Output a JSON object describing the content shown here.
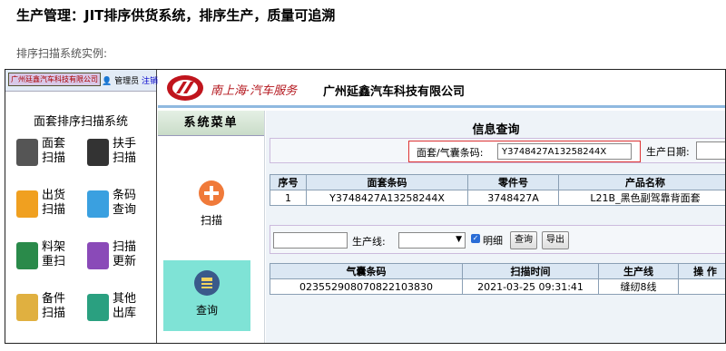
{
  "heading": "生产管理：JIT排序供货系统，排序生产，质量可追溯",
  "subheading": "排序扫描系统实例:",
  "phone": {
    "company": "广州廷鑫汽车科技有限公司",
    "user_prefix": "管理员",
    "user_link": "注销",
    "title": "面套排序扫描系统",
    "items": [
      {
        "label": "面套\n扫描",
        "icon": "seat-icon",
        "color": "#555555"
      },
      {
        "label": "扶手\n扫描",
        "icon": "armrest-icon",
        "color": "#333333"
      },
      {
        "label": "出货\n扫描",
        "icon": "truck-icon",
        "color": "#f0a020"
      },
      {
        "label": "条码\n查询",
        "icon": "barcode-search-icon",
        "color": "#3aa0e0"
      },
      {
        "label": "料架\n重扫",
        "icon": "rack-icon",
        "color": "#2a8a4a"
      },
      {
        "label": "扫描\n更新",
        "icon": "update-icon",
        "color": "#8a4ab8"
      },
      {
        "label": "备件\n扫描",
        "icon": "box-icon",
        "color": "#e0b040"
      },
      {
        "label": "其他\n出库",
        "icon": "export-icon",
        "color": "#2aa080"
      }
    ]
  },
  "desktop": {
    "brand": "南上海·汽车服务",
    "company": "广州延鑫汽车科技有限公司",
    "menu_title": "系统菜单",
    "menu_scan": "扫描",
    "menu_query": "查询",
    "info_title": "信息查询",
    "search": {
      "label": "面套/气囊条码:",
      "value": "Y3748427A13258244X",
      "date_label": "生产日期:"
    },
    "table1": {
      "headers": [
        "序号",
        "面套条码",
        "零件号",
        "产品名称"
      ],
      "rows": [
        [
          "1",
          "Y3748427A13258244X",
          "3748427A",
          "L21B_黑色副驾靠背面套"
        ]
      ]
    },
    "filter": {
      "line_label": "生产线:",
      "detail_label": "明细",
      "query_btn": "查询",
      "export_btn": "导出"
    },
    "table2": {
      "headers": [
        "气囊条码",
        "扫描时间",
        "生产线",
        "操 作"
      ],
      "rows": [
        [
          "023552908070822103830",
          "2021-03-25 09:31:41",
          "缝纫8线",
          ""
        ]
      ]
    }
  }
}
